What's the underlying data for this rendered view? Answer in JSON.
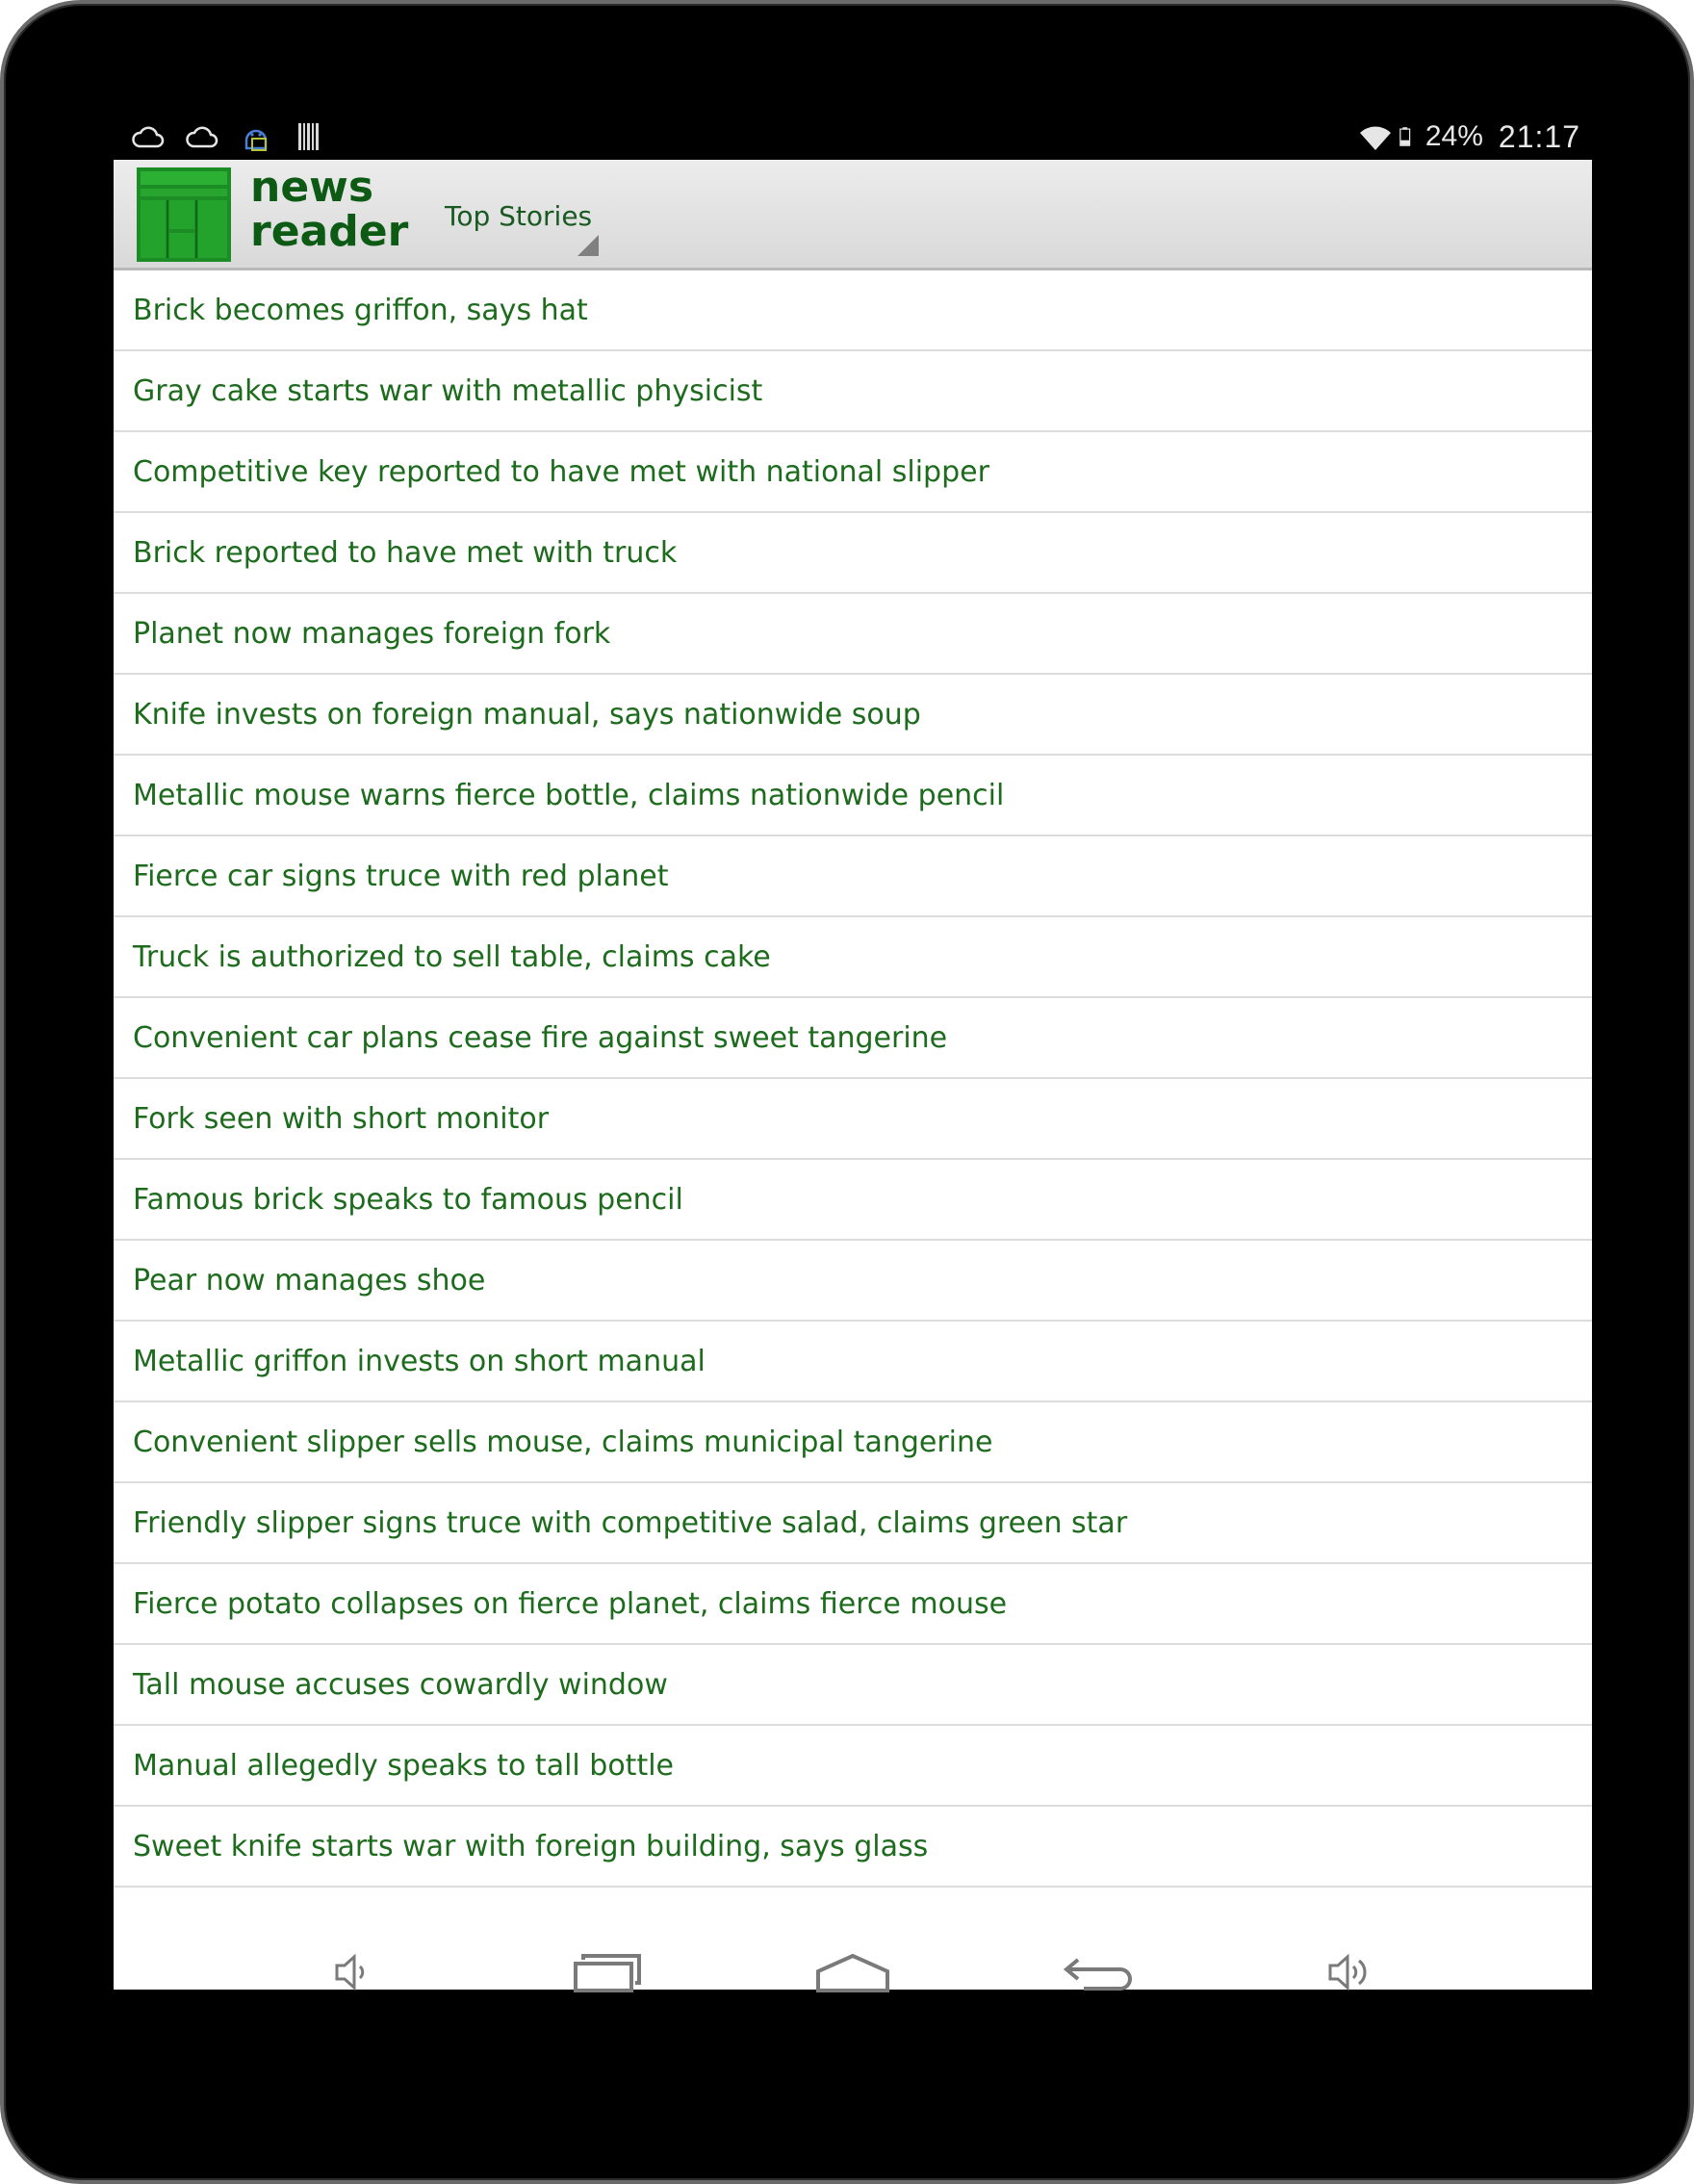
{
  "status_bar": {
    "left_icons": [
      "cloud-icon",
      "cloud-icon",
      "android-debug-icon",
      "barcode-icon"
    ],
    "battery": "24%",
    "time": "21:17"
  },
  "action_bar": {
    "app_name_line1": "news",
    "app_name_line2": "reader",
    "spinner_selected": "Top Stories"
  },
  "headlines": [
    "Brick becomes griffon, says hat",
    "Gray cake starts war with metallic physicist",
    "Competitive key reported to have met with national slipper",
    "Brick reported to have met with truck",
    "Planet now manages foreign fork",
    "Knife invests on foreign manual, says nationwide soup",
    "Metallic mouse warns fierce bottle, claims nationwide pencil",
    "Fierce car signs truce with red planet",
    "Truck is authorized to sell table, claims cake",
    "Convenient car plans cease fire against sweet tangerine",
    "Fork seen with short monitor",
    "Famous brick speaks to famous pencil",
    "Pear now manages shoe",
    "Metallic griffon invests on short manual",
    "Convenient slipper sells mouse, claims municipal tangerine",
    "Friendly slipper signs truce with competitive salad, claims green star",
    "Fierce potato collapses on fierce planet, claims fierce mouse",
    "Tall mouse accuses cowardly window",
    "Manual allegedly speaks to tall bottle",
    "Sweet knife starts war with foreign building, says glass"
  ],
  "navigation": [
    "volume-down-icon",
    "recent-apps-icon",
    "home-icon",
    "back-icon",
    "volume-up-icon"
  ],
  "colors": {
    "brand_green": "#0d5a14",
    "headline_green": "#1d6b1d",
    "list_background": "#ffffff"
  }
}
